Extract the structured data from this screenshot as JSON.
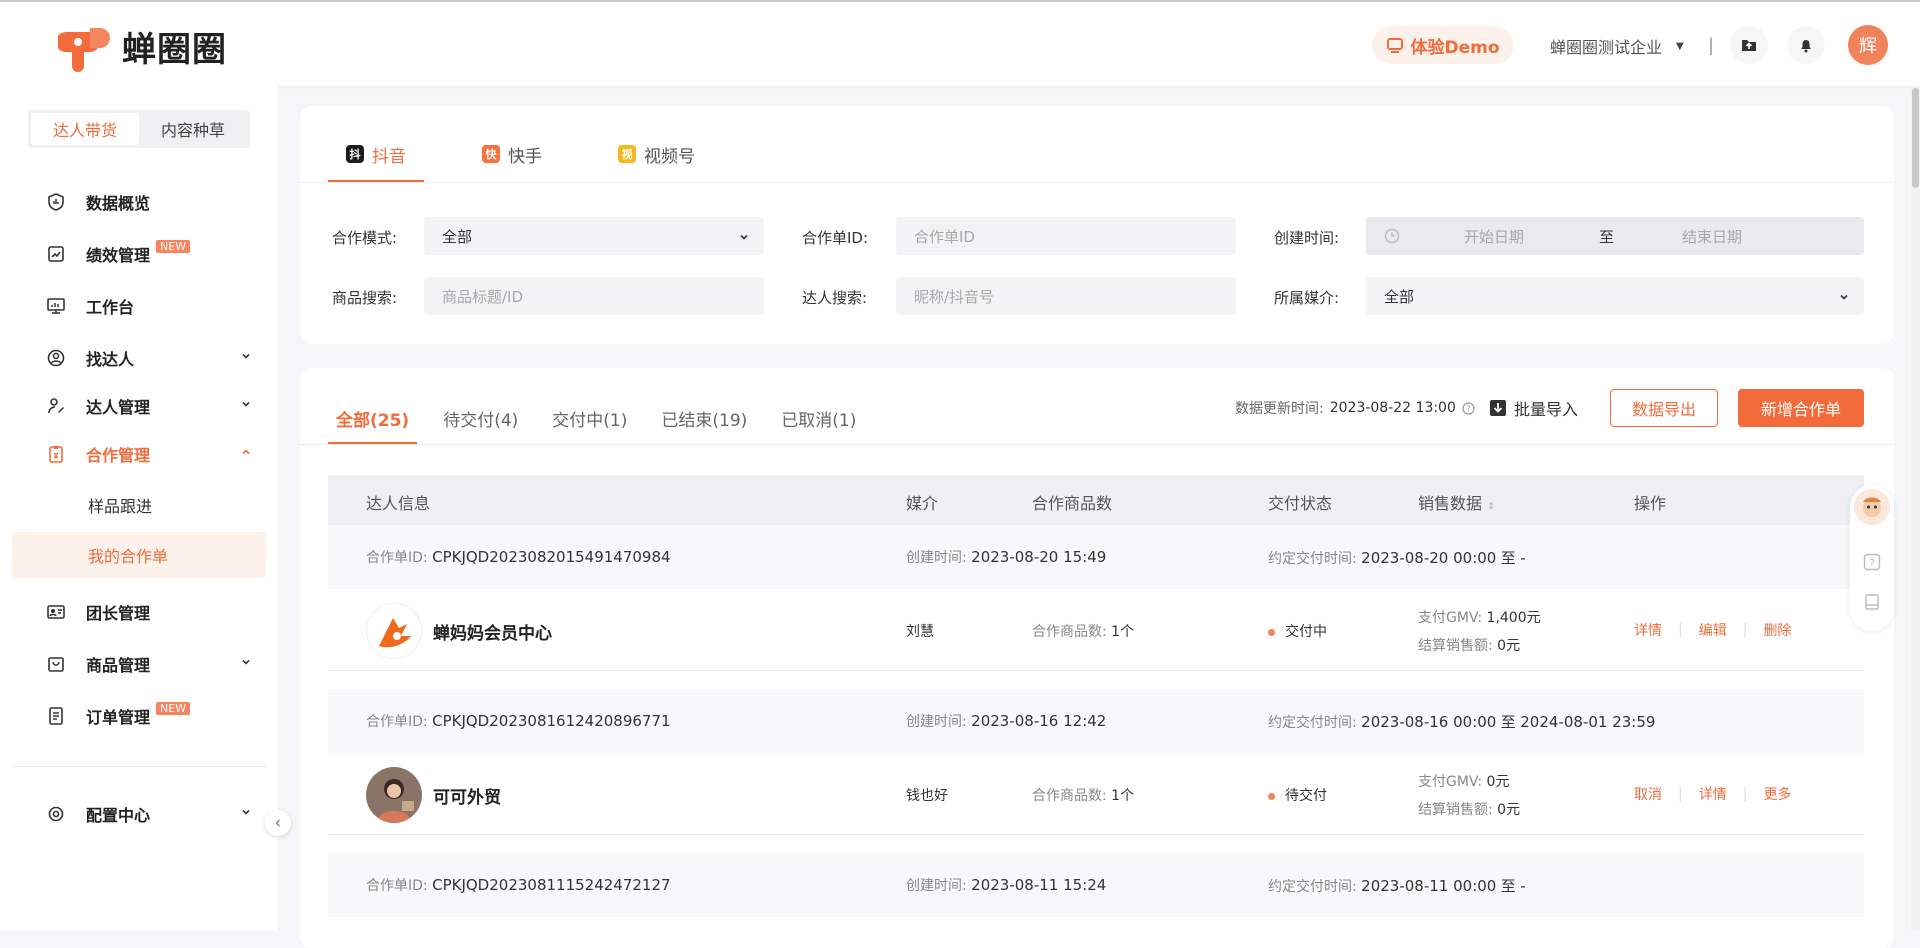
{
  "header": {
    "logo_text": "蝉圈圈",
    "demo_label": "体验Demo",
    "company": "蝉圈圈测试企业",
    "separator": "|",
    "avatar_char": "辉"
  },
  "sidebar": {
    "segments": [
      "达人带货",
      "内容种草"
    ],
    "items": [
      {
        "label": "数据概览"
      },
      {
        "label": "绩效管理",
        "badge": "NEW"
      },
      {
        "label": "工作台"
      },
      {
        "label": "找达人"
      },
      {
        "label": "达人管理"
      },
      {
        "label": "合作管理"
      },
      {
        "label": "样品跟进"
      },
      {
        "label": "我的合作单"
      },
      {
        "label": "团长管理"
      },
      {
        "label": "商品管理"
      },
      {
        "label": "订单管理",
        "badge": "NEW"
      },
      {
        "label": "配置中心"
      }
    ]
  },
  "platform_tabs": [
    {
      "label": "抖音",
      "icon_char": "抖"
    },
    {
      "label": "快手",
      "icon_char": "快"
    },
    {
      "label": "视频号",
      "icon_char": "视"
    }
  ],
  "filters": {
    "mode_label": "合作模式:",
    "mode_value": "全部",
    "order_id_label": "合作单ID:",
    "order_id_placeholder": "合作单ID",
    "created_label": "创建时间:",
    "start_placeholder": "开始日期",
    "range_sep": "至",
    "end_placeholder": "结束日期",
    "product_label": "商品搜索:",
    "product_placeholder": "商品标题/ID",
    "talent_label": "达人搜索:",
    "talent_placeholder": "昵称/抖音号",
    "media_label": "所属媒介:",
    "media_value": "全部"
  },
  "status_tabs": [
    "全部(25)",
    "待交付(4)",
    "交付中(1)",
    "已结束(19)",
    "已取消(1)"
  ],
  "toolbar": {
    "update_label": "数据更新时间:",
    "update_value": "2023-08-22 13:00",
    "import_label": "批量导入",
    "export_label": "数据导出",
    "new_label": "新增合作单"
  },
  "table": {
    "headers": [
      "达人信息",
      "媒介",
      "合作商品数",
      "交付状态",
      "销售数据",
      "操作"
    ],
    "labels": {
      "order_id": "合作单ID:",
      "created": "创建时间:",
      "deadline": "约定交付时间:",
      "to": "至",
      "product_count": "合作商品数:",
      "gmv": "支付GMV:",
      "settle": "结算销售额:"
    },
    "rows": [
      {
        "order_id": "CPKJQD2023082015491470984",
        "created": "2023-08-20 15:49",
        "deadline_start": "2023-08-20 00:00",
        "deadline_end": "-",
        "talent": "蝉妈妈会员中心",
        "media": "刘慧",
        "product_count": "1个",
        "status": "交付中",
        "gmv": "1,400元",
        "settle": "0元",
        "ops": [
          "详情",
          "编辑",
          "删除"
        ]
      },
      {
        "order_id": "CPKJQD2023081612420896771",
        "created": "2023-08-16 12:42",
        "deadline_start": "2023-08-16 00:00",
        "deadline_end": "2024-08-01 23:59",
        "talent": "可可外贸",
        "media": "钱也好",
        "product_count": "1个",
        "status": "待交付",
        "gmv": "0元",
        "settle": "0元",
        "ops": [
          "取消",
          "详情",
          "更多"
        ]
      },
      {
        "order_id": "CPKJQD2023081115242472127",
        "created": "2023-08-11 15:24",
        "deadline_start": "2023-08-11 00:00",
        "deadline_end": "-"
      }
    ]
  },
  "colors": {
    "accent": "#f26b3a",
    "accent_light": "#fdf1ec"
  }
}
